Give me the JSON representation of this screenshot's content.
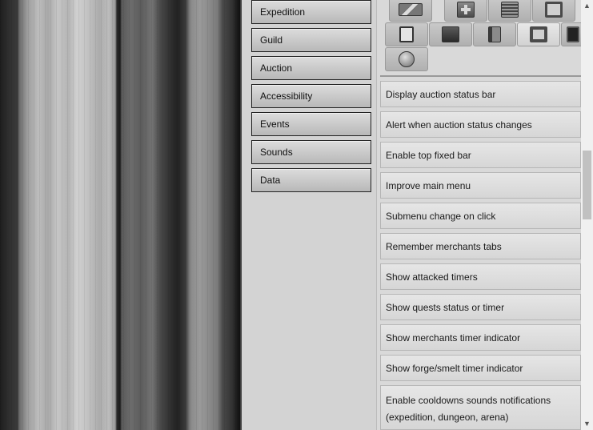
{
  "sidebar": {
    "items": [
      {
        "label": "Expedition"
      },
      {
        "label": "Guild"
      },
      {
        "label": "Auction"
      },
      {
        "label": "Accessibility"
      },
      {
        "label": "Events"
      },
      {
        "label": "Sounds"
      },
      {
        "label": "Data"
      }
    ]
  },
  "icon_tabs": [
    {
      "icon": "quill-icon"
    },
    {
      "icon": "cross-icon"
    },
    {
      "icon": "ledger-icon"
    },
    {
      "icon": "frame-icon"
    },
    {
      "icon": "clipboard-icon"
    },
    {
      "icon": "castle-icon"
    },
    {
      "icon": "book-icon"
    },
    {
      "icon": "portrait-icon"
    },
    {
      "icon": "dark-frame-icon"
    },
    {
      "icon": "orb-icon"
    }
  ],
  "options": [
    {
      "label": "Display auction status bar"
    },
    {
      "label": "Alert when auction status changes"
    },
    {
      "label": "Enable top fixed bar"
    },
    {
      "label": "Improve main menu"
    },
    {
      "label": "Submenu change on click"
    },
    {
      "label": "Remember merchants tabs"
    },
    {
      "label": "Show attacked timers"
    },
    {
      "label": "Show quests status or timer"
    },
    {
      "label": "Show merchants timer indicator"
    },
    {
      "label": "Show forge/smelt timer indicator"
    },
    {
      "label": "Enable cooldowns sounds notifications (expedition, dungeon, arena)"
    }
  ],
  "scrollbar": {
    "up_arrow": "▲",
    "down_arrow": "▼"
  }
}
